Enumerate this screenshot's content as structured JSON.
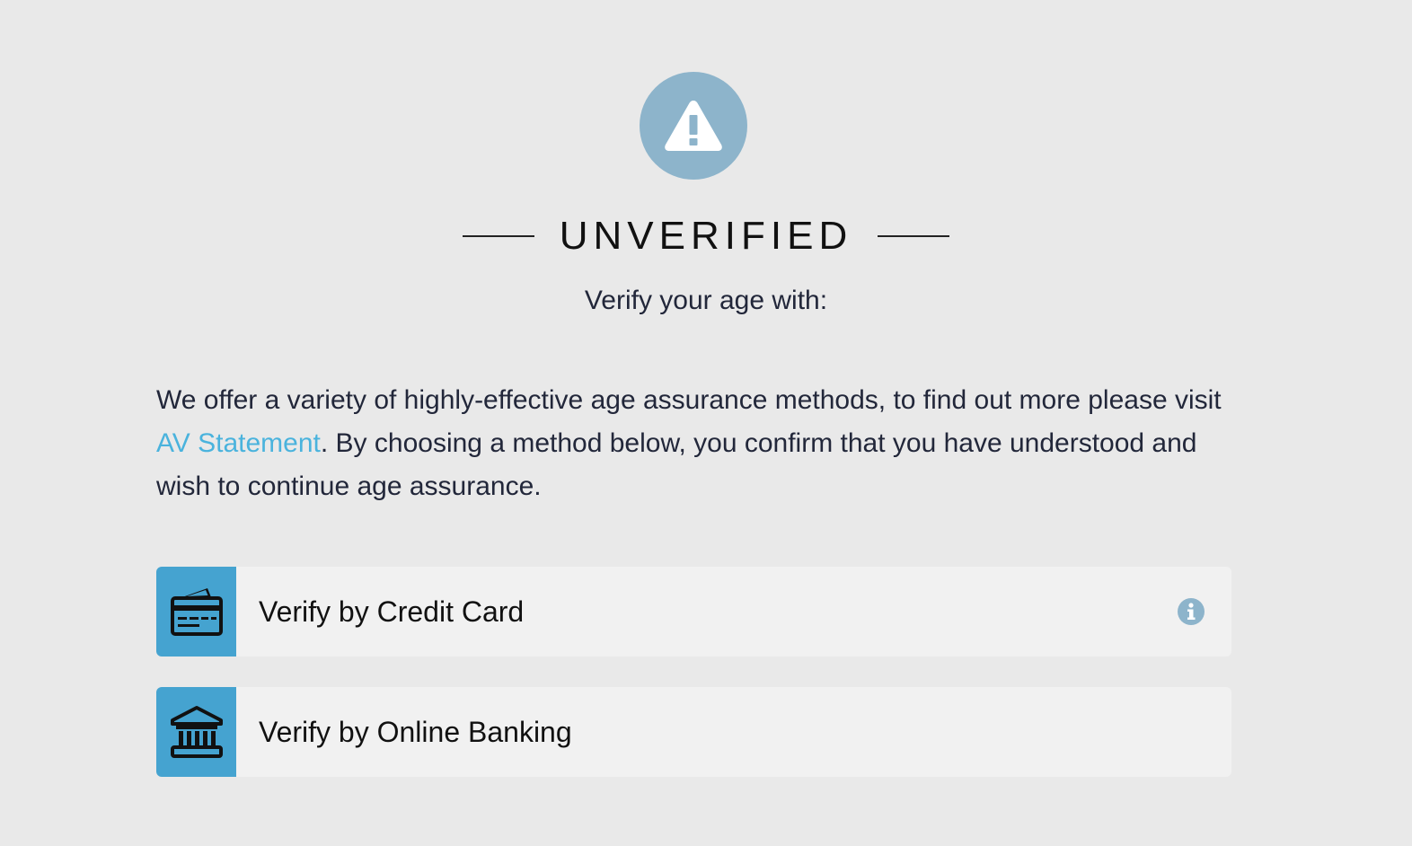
{
  "status": {
    "icon": "warning-triangle-icon",
    "icon_bg_color": "#8db4cb",
    "title": "UNVERIFIED",
    "subtitle": "Verify your age with:"
  },
  "description": {
    "text_before_link": "We offer a variety of highly-effective age assurance methods, to find out more please visit ",
    "link_text": "AV Statement",
    "text_after_link": ". By choosing a method below, you confirm that you have understood and wish to continue age assurance.",
    "link_color": "#4ab3dd"
  },
  "options": [
    {
      "label": "Verify by Credit Card",
      "icon": "credit-card-icon",
      "info_icon": "info-icon"
    },
    {
      "label": "Verify by Online Banking",
      "icon": "bank-icon"
    }
  ],
  "colors": {
    "background": "#e9e9e9",
    "option_background": "#f1f1f1",
    "option_icon_background": "#45a3d0",
    "info_icon": "#8db4cb"
  }
}
